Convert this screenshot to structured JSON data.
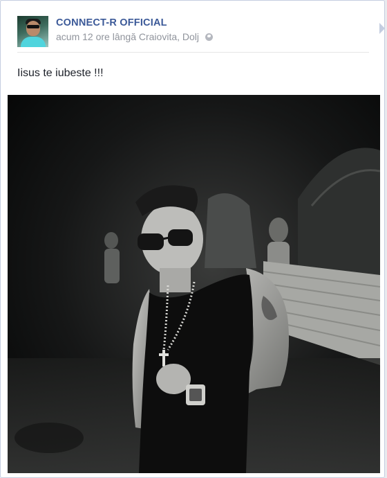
{
  "post": {
    "author": "CONNECT-R OFFICIAL",
    "timestamp": "acum 12 ore",
    "location_prefix": "lângă",
    "location": "Craiovita, Dolj",
    "text": "Iisus te iubeste !!!",
    "privacy_icon": "globe-icon"
  },
  "colors": {
    "link": "#3b5998",
    "meta": "#90949c",
    "text": "#1d2129"
  }
}
